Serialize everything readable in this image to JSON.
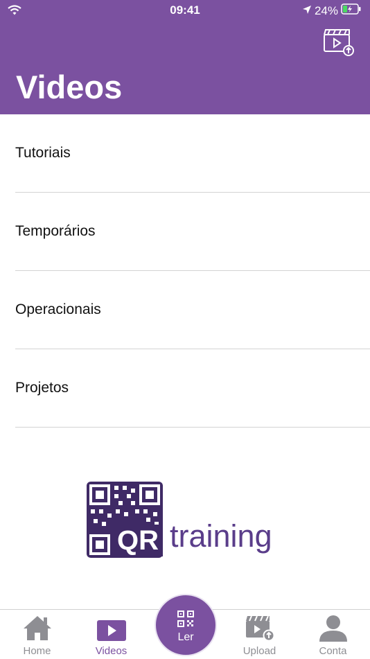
{
  "status_bar": {
    "time": "09:41",
    "battery": "24%"
  },
  "header": {
    "title": "Videos"
  },
  "categories": [
    {
      "label": "Tutoriais"
    },
    {
      "label": "Temporários"
    },
    {
      "label": "Operacionais"
    },
    {
      "label": "Projetos"
    }
  ],
  "logo": {
    "qr_text": "QR",
    "training_text": "training"
  },
  "tab_bar": {
    "home": "Home",
    "videos": "Videos",
    "ler": "Ler",
    "upload": "Upload",
    "conta": "Conta"
  },
  "colors": {
    "brand": "#7b51a0",
    "logo": "#3f2a66"
  }
}
